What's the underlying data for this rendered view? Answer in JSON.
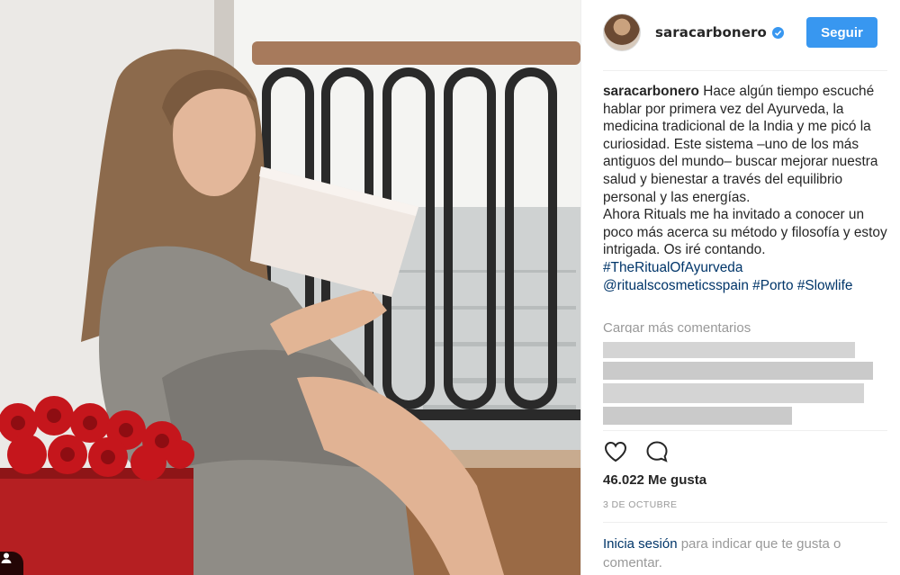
{
  "post": {
    "author": {
      "username": "saracarbonero",
      "verified": true
    },
    "follow_label": "Seguir",
    "caption": {
      "author": "saracarbonero",
      "text": " Hace algún tiempo escuché hablar por primera vez del Ayurveda, la medicina tradicional de la India y me picó la curiosidad. Este sistema –uno de los más antiguos del mundo– buscar mejorar nuestra salud y bienestar a través del equilibrio personal y las energías.",
      "text2": "Ahora Rituals me ha invitado a conocer un poco más acerca su método y filosofía y estoy intrigada. Os iré contando.",
      "hashtags": [
        "#TheRitualOfAyurveda",
        "@ritualscosmeticsspain",
        "#Porto",
        "#Slowlife"
      ]
    },
    "load_more": "Cargar más comentarios",
    "likes": "46.022 Me gusta",
    "date": "3 DE OCTUBRE",
    "login": {
      "link": "Inicia sesión",
      "rest": " para indicar que te gusta o comentar."
    },
    "icons": {
      "like": "heart-icon",
      "comment": "comment-icon",
      "user_tag": "user-tag-icon",
      "verified": "verified-badge-icon",
      "more": "ellipsis-icon"
    },
    "colors": {
      "accent": "#3897f0",
      "link": "#003569",
      "muted": "#999999",
      "text": "#262626"
    }
  }
}
